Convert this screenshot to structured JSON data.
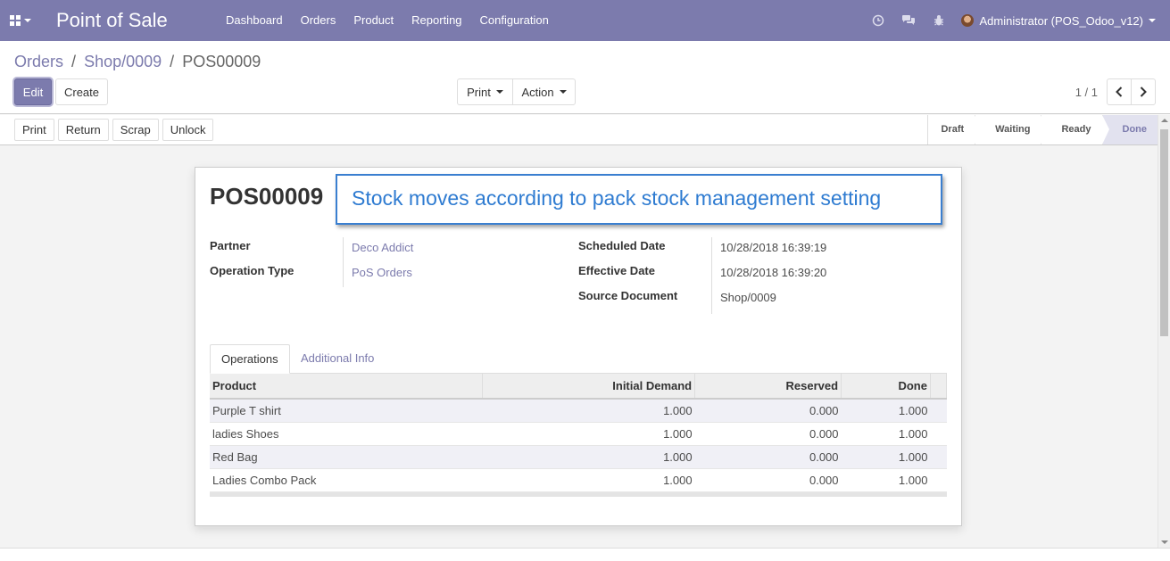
{
  "navbar": {
    "app_title": "Point of Sale",
    "menu": [
      "Dashboard",
      "Orders",
      "Product",
      "Reporting",
      "Configuration"
    ],
    "user_name": "Administrator (POS_Odoo_v12)",
    "colors": {
      "primary": "#7c7bad"
    }
  },
  "breadcrumb": [
    "Orders",
    "Shop/0009",
    "POS00009"
  ],
  "control_panel": {
    "edit_label": "Edit",
    "create_label": "Create",
    "print_label": "Print",
    "action_label": "Action",
    "pager_value": "1 / 1"
  },
  "statusbar": {
    "buttons": [
      "Print",
      "Return",
      "Scrap",
      "Unlock"
    ],
    "stages": [
      "Draft",
      "Waiting",
      "Ready",
      "Done"
    ],
    "active_stage": "Done"
  },
  "record": {
    "name": "POS00009",
    "callout": "Stock moves according to pack stock management setting",
    "partner_label": "Partner",
    "partner_value": "Deco Addict",
    "operation_type_label": "Operation Type",
    "operation_type_value": "PoS Orders",
    "scheduled_date_label": "Scheduled Date",
    "scheduled_date_value": "10/28/2018 16:39:19",
    "effective_date_label": "Effective Date",
    "effective_date_value": "10/28/2018 16:39:20",
    "source_document_label": "Source Document",
    "source_document_value": "Shop/0009"
  },
  "tabs": [
    "Operations",
    "Additional Info"
  ],
  "operations": {
    "columns": [
      "Product",
      "Initial Demand",
      "Reserved",
      "Done"
    ],
    "rows": [
      {
        "product": "Purple T shirt",
        "initial_demand": "1.000",
        "reserved": "0.000",
        "done": "1.000"
      },
      {
        "product": "ladies Shoes",
        "initial_demand": "1.000",
        "reserved": "0.000",
        "done": "1.000"
      },
      {
        "product": "Red Bag",
        "initial_demand": "1.000",
        "reserved": "0.000",
        "done": "1.000"
      },
      {
        "product": "Ladies Combo Pack",
        "initial_demand": "1.000",
        "reserved": "0.000",
        "done": "1.000"
      }
    ]
  }
}
